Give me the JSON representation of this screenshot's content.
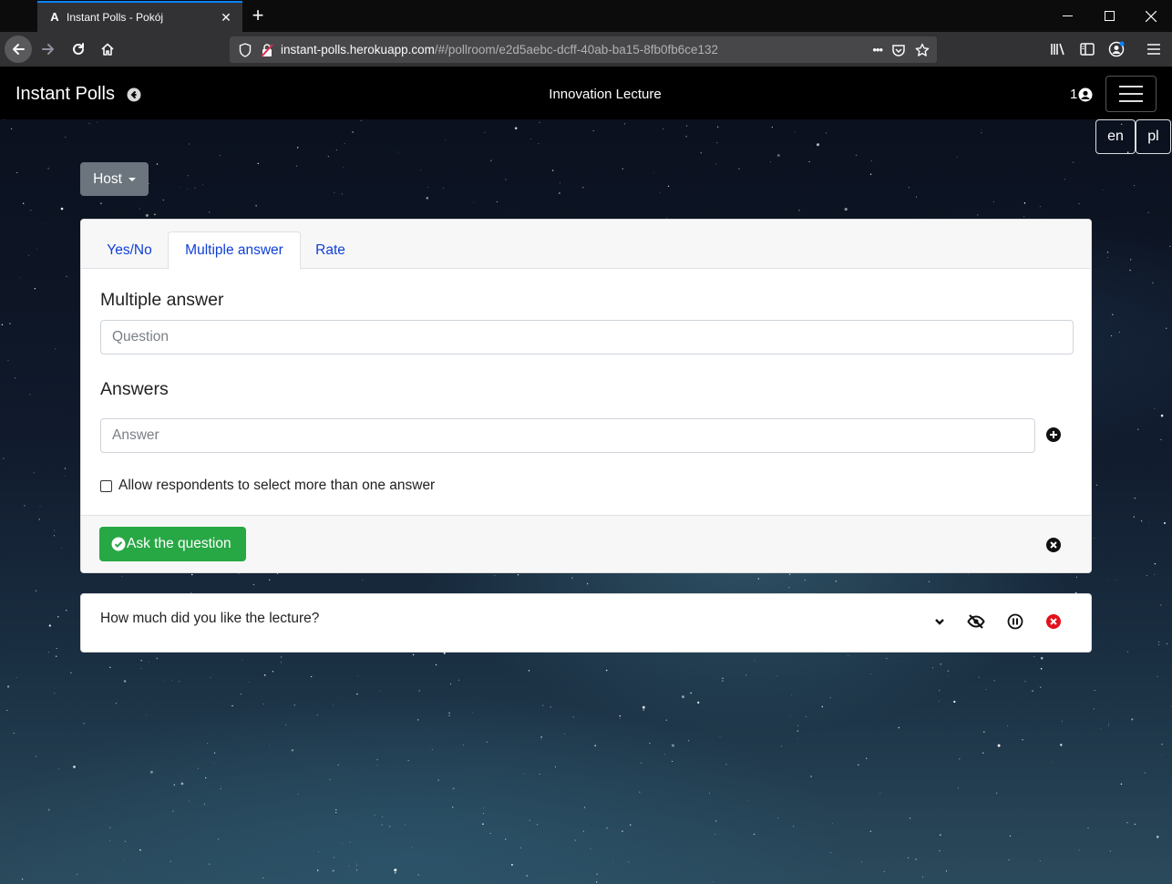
{
  "browser": {
    "tab_title": "Instant Polls - Pokój",
    "tab_favicon": "A",
    "url_main": "instant-polls.herokuapp.com",
    "url_rest": "/#/pollroom/e2d5aebc-dcff-40ab-ba15-8fb0fb6ce132",
    "url_overflow": "•••"
  },
  "app": {
    "brand": "Instant Polls",
    "room_title": "Innovation Lecture",
    "user_count": "1",
    "languages": [
      "en",
      "pl"
    ],
    "host_label": "Host"
  },
  "poll_form": {
    "tabs": [
      {
        "label": "Yes/No",
        "active": false
      },
      {
        "label": "Multiple answer",
        "active": true
      },
      {
        "label": "Rate",
        "active": false
      }
    ],
    "title": "Multiple answer",
    "question_placeholder": "Question",
    "answers_title": "Answers",
    "answer_placeholder": "Answer",
    "multi_select_label": "Allow respondents to select more than one answer",
    "multi_select_checked": false,
    "ask_label": "Ask the question"
  },
  "questions": [
    {
      "text": "How much did you like the lecture?"
    }
  ],
  "colors": {
    "accent": "#0f3fd6",
    "success": "#28a745",
    "danger": "#e3101b",
    "secondary": "#6c757d"
  }
}
